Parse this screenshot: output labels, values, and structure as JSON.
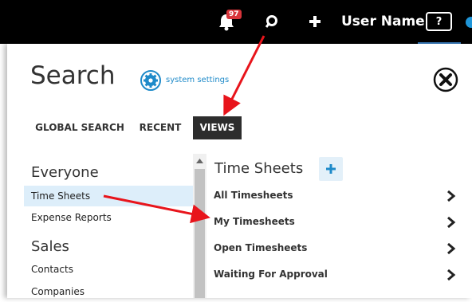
{
  "topbar": {
    "notification_count": "97",
    "user_name": "User Name",
    "help_label": "?",
    "icons": [
      "bell-icon",
      "search-icon",
      "plus-icon",
      "help-icon"
    ]
  },
  "panel": {
    "title": "Search",
    "settings_link": "system settings",
    "tabs": [
      {
        "label": "GLOBAL SEARCH",
        "active": false
      },
      {
        "label": "RECENT",
        "active": false
      },
      {
        "label": "VIEWS",
        "active": true
      }
    ]
  },
  "sidebar": {
    "groups": [
      {
        "heading": "Everyone",
        "items": [
          "Time Sheets",
          "Expense Reports"
        ],
        "selected": "Time Sheets"
      },
      {
        "heading": "Sales",
        "items": [
          "Contacts",
          "Companies"
        ]
      }
    ]
  },
  "views": {
    "title": "Time Sheets",
    "items": [
      "All Timesheets",
      "My Timesheets",
      "Open Timesheets",
      "Waiting For Approval"
    ]
  },
  "colors": {
    "accent": "#1e8ac9",
    "selected_row": "#ddeefa",
    "annotation": "#e8141b",
    "badge": "#d8343a"
  }
}
